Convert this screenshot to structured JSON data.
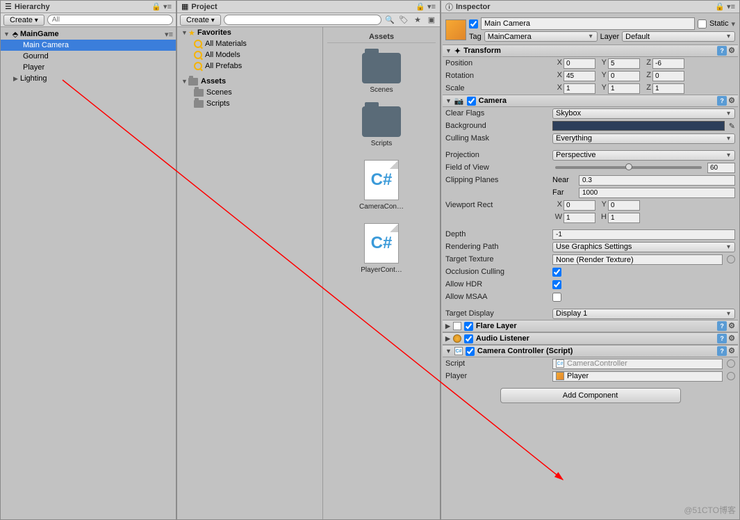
{
  "hierarchy": {
    "title": "Hierarchy",
    "create": "Create",
    "search_ph": "All",
    "scene": "MainGame",
    "items": [
      "Main Camera",
      "Gournd",
      "Player",
      "Lighting"
    ]
  },
  "project": {
    "title": "Project",
    "create": "Create",
    "favorites": "Favorites",
    "fav_items": [
      "All Materials",
      "All Models",
      "All Prefabs"
    ],
    "assets": "Assets",
    "asset_folders": [
      "Scenes",
      "Scripts"
    ],
    "assets_hdr": "Assets",
    "grid": [
      "Scenes",
      "Scripts",
      "CameraCon…",
      "PlayerCont…"
    ]
  },
  "inspector": {
    "title": "Inspector",
    "obj_name": "Main Camera",
    "static": "Static",
    "tag_label": "Tag",
    "tag_value": "MainCamera",
    "layer_label": "Layer",
    "layer_value": "Default",
    "transform": {
      "title": "Transform",
      "position": {
        "label": "Position",
        "x": "0",
        "y": "5",
        "z": "-6"
      },
      "rotation": {
        "label": "Rotation",
        "x": "45",
        "y": "0",
        "z": "0"
      },
      "scale": {
        "label": "Scale",
        "x": "1",
        "y": "1",
        "z": "1"
      }
    },
    "camera": {
      "title": "Camera",
      "clear_flags": {
        "label": "Clear Flags",
        "value": "Skybox"
      },
      "background": "Background",
      "culling_mask": {
        "label": "Culling Mask",
        "value": "Everything"
      },
      "projection": {
        "label": "Projection",
        "value": "Perspective"
      },
      "fov": {
        "label": "Field of View",
        "value": "60"
      },
      "clipping": {
        "label": "Clipping Planes",
        "near_l": "Near",
        "near": "0.3",
        "far_l": "Far",
        "far": "1000"
      },
      "viewport": {
        "label": "Viewport Rect",
        "x": "0",
        "y": "0",
        "w": "1",
        "h": "1"
      },
      "depth": {
        "label": "Depth",
        "value": "-1"
      },
      "rendering_path": {
        "label": "Rendering Path",
        "value": "Use Graphics Settings"
      },
      "target_texture": {
        "label": "Target Texture",
        "value": "None (Render Texture)"
      },
      "occlusion": "Occlusion Culling",
      "hdr": "Allow HDR",
      "msaa": "Allow MSAA",
      "target_display": {
        "label": "Target Display",
        "value": "Display 1"
      }
    },
    "flare": "Flare Layer",
    "audio": "Audio Listener",
    "controller": {
      "title": "Camera Controller (Script)",
      "script_l": "Script",
      "script_v": "CameraController",
      "player_l": "Player",
      "player_v": "Player"
    },
    "add_component": "Add Component"
  },
  "watermark": "@51CTO博客"
}
